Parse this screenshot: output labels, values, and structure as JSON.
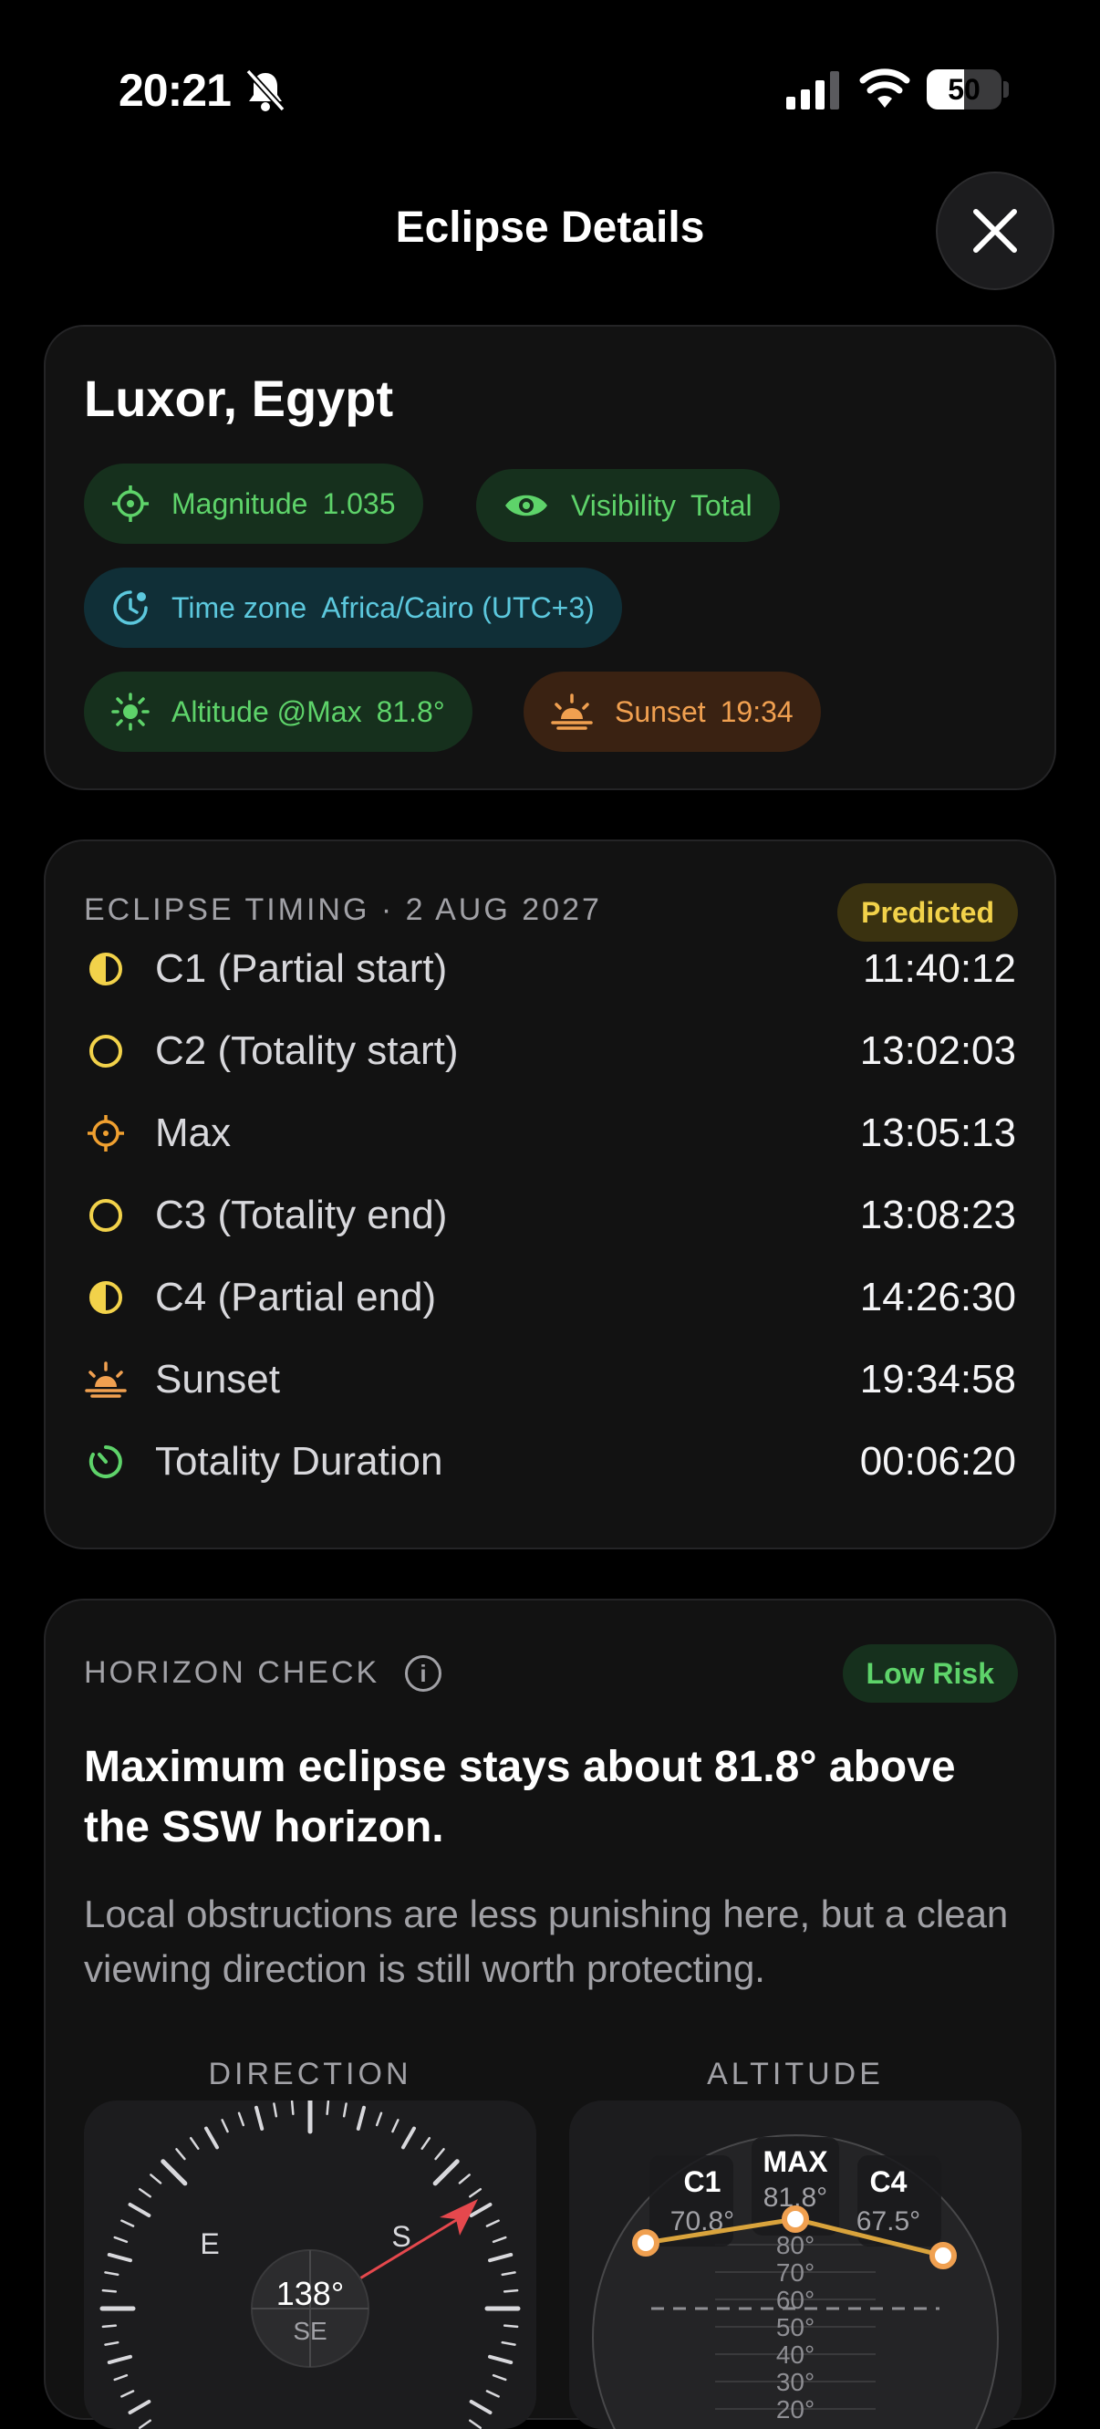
{
  "status_bar": {
    "time": "20:21",
    "battery": "50"
  },
  "header": {
    "title": "Eclipse Details"
  },
  "location": {
    "name": "Luxor, Egypt",
    "chips": {
      "magnitude": {
        "label": "Magnitude",
        "value": "1.035"
      },
      "visibility": {
        "label": "Visibility",
        "value": "Total"
      },
      "timezone": {
        "label": "Time zone",
        "value": "Africa/Cairo (UTC+3)"
      },
      "altitude": {
        "label": "Altitude @Max",
        "value": "81.8°"
      },
      "sunset": {
        "label": "Sunset",
        "value": "19:34"
      }
    }
  },
  "timing": {
    "title": "ECLIPSE TIMING · 2 AUG 2027",
    "badge": "Predicted",
    "rows": [
      {
        "label": "C1 (Partial start)",
        "value": "11:40:12",
        "icon": "half-circle-icon"
      },
      {
        "label": "C2 (Totality start)",
        "value": "13:02:03",
        "icon": "ring-icon"
      },
      {
        "label": "Max",
        "value": "13:05:13",
        "icon": "crosshair-icon"
      },
      {
        "label": "C3 (Totality end)",
        "value": "13:08:23",
        "icon": "ring-icon"
      },
      {
        "label": "C4 (Partial end)",
        "value": "14:26:30",
        "icon": "half-circle-icon"
      },
      {
        "label": "Sunset",
        "value": "19:34:58",
        "icon": "sunset-icon"
      },
      {
        "label": "Totality Duration",
        "value": "00:06:20",
        "icon": "timer-icon"
      }
    ]
  },
  "horizon": {
    "title": "HORIZON CHECK",
    "badge": "Low Risk",
    "headline": "Maximum eclipse stays about 81.8° above the SSW horizon.",
    "body": "Local obstructions are less punishing here, but a clean viewing direction is still worth protecting.",
    "direction": {
      "title": "DIRECTION",
      "cardinal_e": "E",
      "cardinal_s": "S",
      "bearing": "138°",
      "bearing_dir": "SE"
    },
    "altitude": {
      "title": "ALTITUDE",
      "c1_label": "C1",
      "c1_value": "70.8°",
      "max_label": "MAX",
      "max_value": "81.8°",
      "c4_label": "C4",
      "c4_value": "67.5°",
      "scale": [
        "80°",
        "70°",
        "60°",
        "50°",
        "40°",
        "30°",
        "20°"
      ]
    }
  },
  "colors": {
    "yellow": "#f2d24a",
    "green": "#5ed36a",
    "orange": "#f0a050",
    "teal": "#5cc8dd",
    "red": "#e5484d"
  }
}
